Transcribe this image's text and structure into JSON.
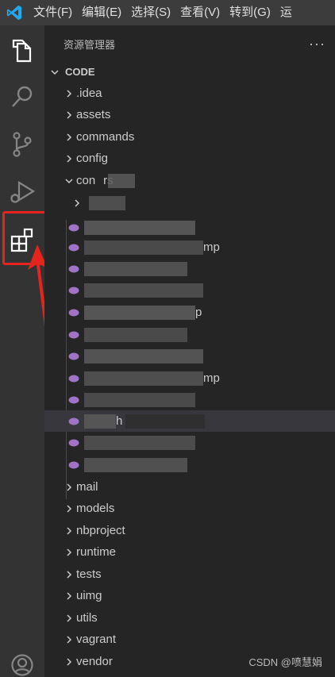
{
  "menu": {
    "items": [
      "文件(F)",
      "编辑(E)",
      "选择(S)",
      "查看(V)",
      "转到(G)",
      "运"
    ]
  },
  "activity_bar": {
    "icons": [
      "explorer-icon",
      "search-icon",
      "source-control-icon",
      "run-debug-icon",
      "extensions-icon",
      "account-icon"
    ]
  },
  "sidebar": {
    "title": "资源管理器",
    "more": "···",
    "root": "CODE",
    "folders_top": [
      ".idea",
      "assets",
      "commands",
      "config"
    ],
    "expanded_folder": "con    rs",
    "partial_labels": [
      "mp",
      "p",
      "mp",
      "h"
    ],
    "folders_bottom": [
      "mail",
      "models",
      "nbproject",
      "runtime",
      "tests",
      "uimg",
      "utils",
      "vagrant",
      "vendor"
    ]
  },
  "colors": {
    "accent": "#0078d4",
    "highlight": "#e4241d",
    "php_icon": "#a074c4"
  },
  "watermark": "CSDN @喷慧娟"
}
